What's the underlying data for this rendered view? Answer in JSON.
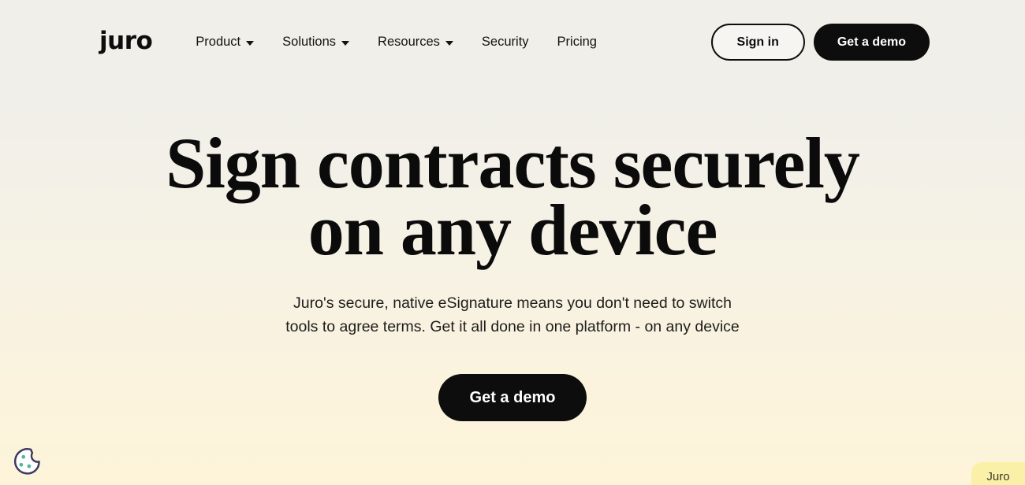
{
  "header": {
    "logo_text": "juro",
    "nav_items": [
      {
        "label": "Product",
        "has_dropdown": true
      },
      {
        "label": "Solutions",
        "has_dropdown": true
      },
      {
        "label": "Resources",
        "has_dropdown": true
      },
      {
        "label": "Security",
        "has_dropdown": false
      },
      {
        "label": "Pricing",
        "has_dropdown": false
      }
    ],
    "sign_in_label": "Sign in",
    "get_demo_label": "Get a demo"
  },
  "hero": {
    "title_line1": "Sign contracts securely",
    "title_line2": "on any device",
    "subtitle": "Juro's secure, native eSignature means you don't need to switch tools to agree terms. Get it all done in one platform - on any device",
    "cta_label": "Get a demo"
  },
  "cookie_widget": {
    "icon": "cookie-icon",
    "outline_color": "#3c3a5e",
    "dot_color": "#4fb79b",
    "fill_color": "#ffffff"
  },
  "chat_widget": {
    "label": "Juro",
    "background_color": "#fbf0a8"
  },
  "theme": {
    "background_top": "#f0efe9",
    "background_bottom": "#fdf4d9",
    "text_color": "#0d0d0d",
    "button_dark": "#0d0d0d",
    "button_light": "#f6f5f1"
  }
}
